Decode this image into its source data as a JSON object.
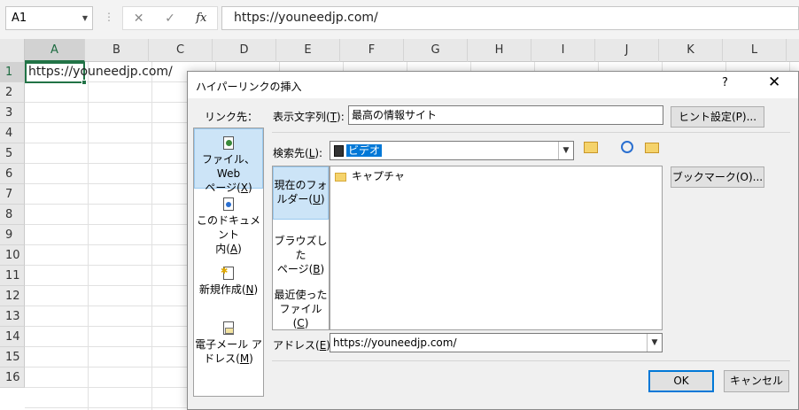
{
  "formula_bar": {
    "name_box": "A1",
    "cancel_icon": "✕",
    "enter_icon": "✓",
    "fx_label": "fx",
    "formula": "https://youneedjp.com/"
  },
  "sheet": {
    "columns": [
      "A",
      "B",
      "C",
      "D",
      "E",
      "F",
      "G",
      "H",
      "I",
      "J",
      "K",
      "L"
    ],
    "rows": [
      "1",
      "2",
      "3",
      "4",
      "5",
      "6",
      "7",
      "8",
      "9",
      "10",
      "11",
      "12",
      "13",
      "14",
      "15",
      "16"
    ],
    "selected_cell": "A1",
    "a1_value": "https://youneedjp.com/"
  },
  "dialog": {
    "title": "ハイパーリンクの挿入",
    "help": "?",
    "close": "✕",
    "link_to_label": "リンク先：",
    "link_to": {
      "file_web_1": "ファイル、Web",
      "file_web_2_pre": "ページ(",
      "file_web_2_key": "X",
      "file_web_2_post": ")",
      "this_doc_1": "このドキュメント",
      "this_doc_2_pre": "内(",
      "this_doc_2_key": "A",
      "this_doc_2_post": ")",
      "new_doc_pre": "新規作成(",
      "new_doc_key": "N",
      "new_doc_post": ")",
      "email_1": "電子メール ア",
      "email_2_pre": "ドレス(",
      "email_2_key": "M",
      "email_2_post": ")"
    },
    "display_text_label_pre": "表示文字列(",
    "display_text_label_key": "T",
    "display_text_label_post": "):",
    "display_text": "最高の情報サイト",
    "screentip_button": "ヒント設定(P)...",
    "look_in_label_pre": "検索先(",
    "look_in_label_key": "L",
    "look_in_label_post": "):",
    "look_in_value": "ビデオ",
    "look_in_nav": {
      "current_1": "現在のフォ",
      "current_2_pre": "ルダー(",
      "current_2_key": "U",
      "current_2_post": ")",
      "browsed_1": "ブラウズした",
      "browsed_2_pre": "ページ(",
      "browsed_2_key": "B",
      "browsed_2_post": ")",
      "recent_1": "最近使った",
      "recent_2_pre": "ファイル(",
      "recent_2_key": "C",
      "recent_2_post": ")"
    },
    "files": [
      "キャプチャ"
    ],
    "bookmark_button": "ブックマーク(O)...",
    "address_label_pre": "アドレス(",
    "address_label_key": "E",
    "address_label_post": "):",
    "address_value": "https://youneedjp.com/",
    "ok_button": "OK",
    "cancel_button": "キャンセル"
  }
}
